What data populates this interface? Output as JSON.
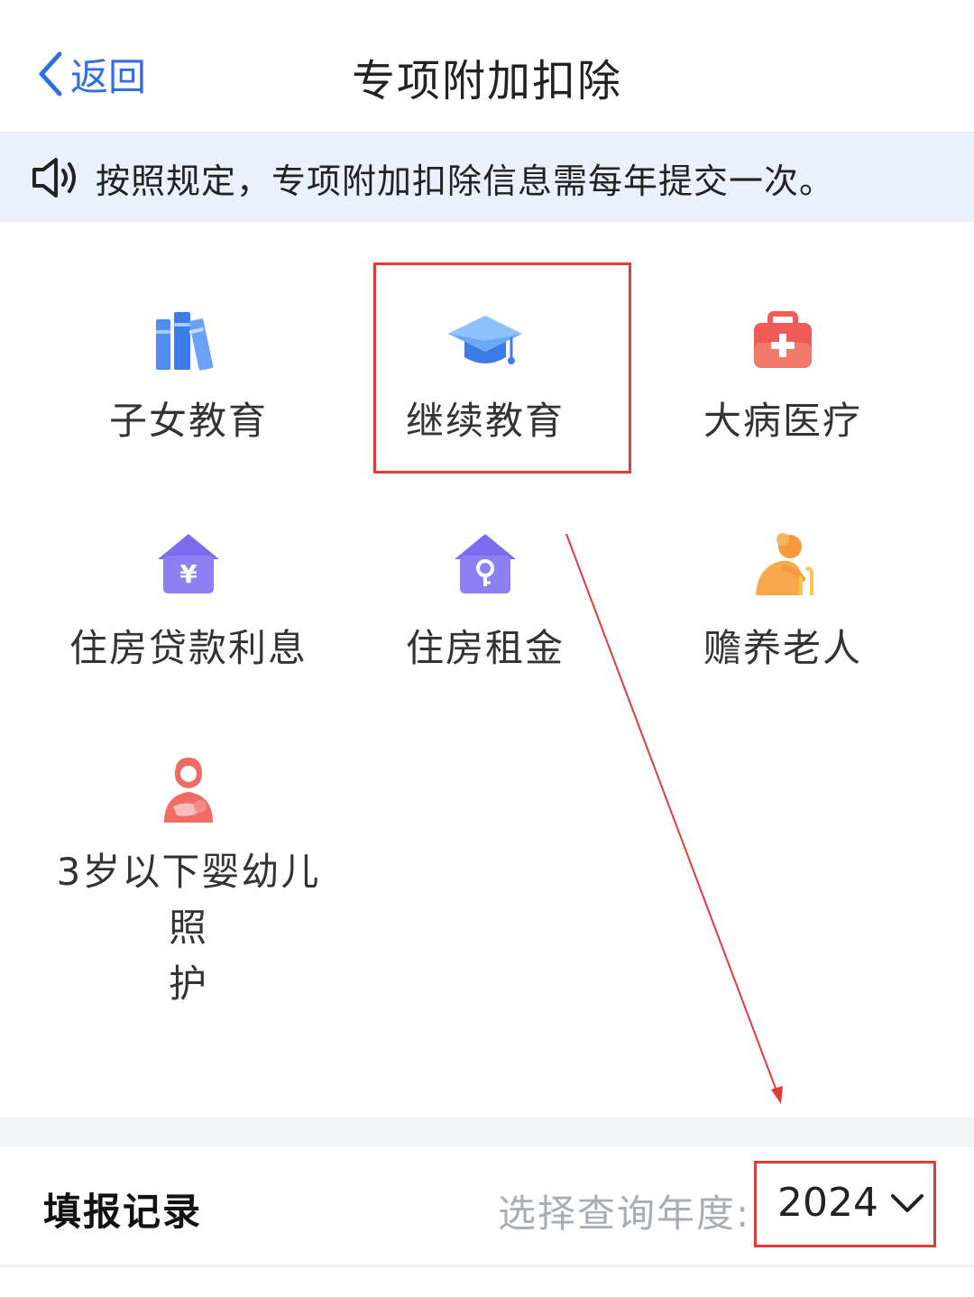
{
  "header": {
    "back_label": "返回",
    "title": "专项附加扣除"
  },
  "notice": {
    "text": "按照规定，专项附加扣除信息需每年提交一次。"
  },
  "categories": [
    {
      "label": "子女教育",
      "icon": "books-icon"
    },
    {
      "label": "继续教育",
      "icon": "graduation-cap-icon"
    },
    {
      "label": "大病医疗",
      "icon": "medical-kit-icon"
    },
    {
      "label": "住房贷款利息",
      "icon": "house-yuan-icon"
    },
    {
      "label": "住房租金",
      "icon": "house-key-icon"
    },
    {
      "label": "赡养老人",
      "icon": "elderly-person-icon"
    },
    {
      "label_line1": "3岁以下婴幼儿照",
      "label_line2": "护",
      "icon": "mother-baby-icon"
    }
  ],
  "records": {
    "title": "填报记录",
    "year_label": "选择查询年度:",
    "year_value": "2024"
  },
  "colors": {
    "accent": "#2f6fe0",
    "highlight": "#e33a3a",
    "notice_bg": "#e8f1fc"
  }
}
